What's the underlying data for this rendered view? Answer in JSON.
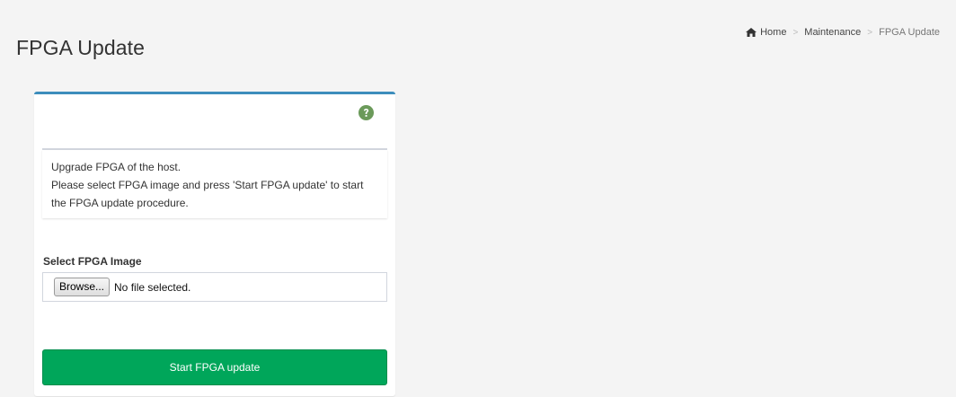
{
  "page": {
    "title": "FPGA Update"
  },
  "breadcrumb": {
    "home": "Home",
    "maintenance": "Maintenance",
    "current": "FPGA Update",
    "separator": ">"
  },
  "info": {
    "line1": "Upgrade FPGA of the host.",
    "line2": "Please select FPGA image and press 'Start FPGA update' to start the FPGA update procedure."
  },
  "form": {
    "image_label": "Select FPGA Image",
    "browse_label": "Browse...",
    "file_status": "No file selected.",
    "submit_label": "Start FPGA update"
  },
  "icons": {
    "home": "home-icon",
    "help": "question-circle-icon"
  },
  "colors": {
    "accent_border": "#3c8dbc",
    "success": "#00a65a",
    "help_icon": "#6b9a5a",
    "background": "#f4f4f4"
  }
}
